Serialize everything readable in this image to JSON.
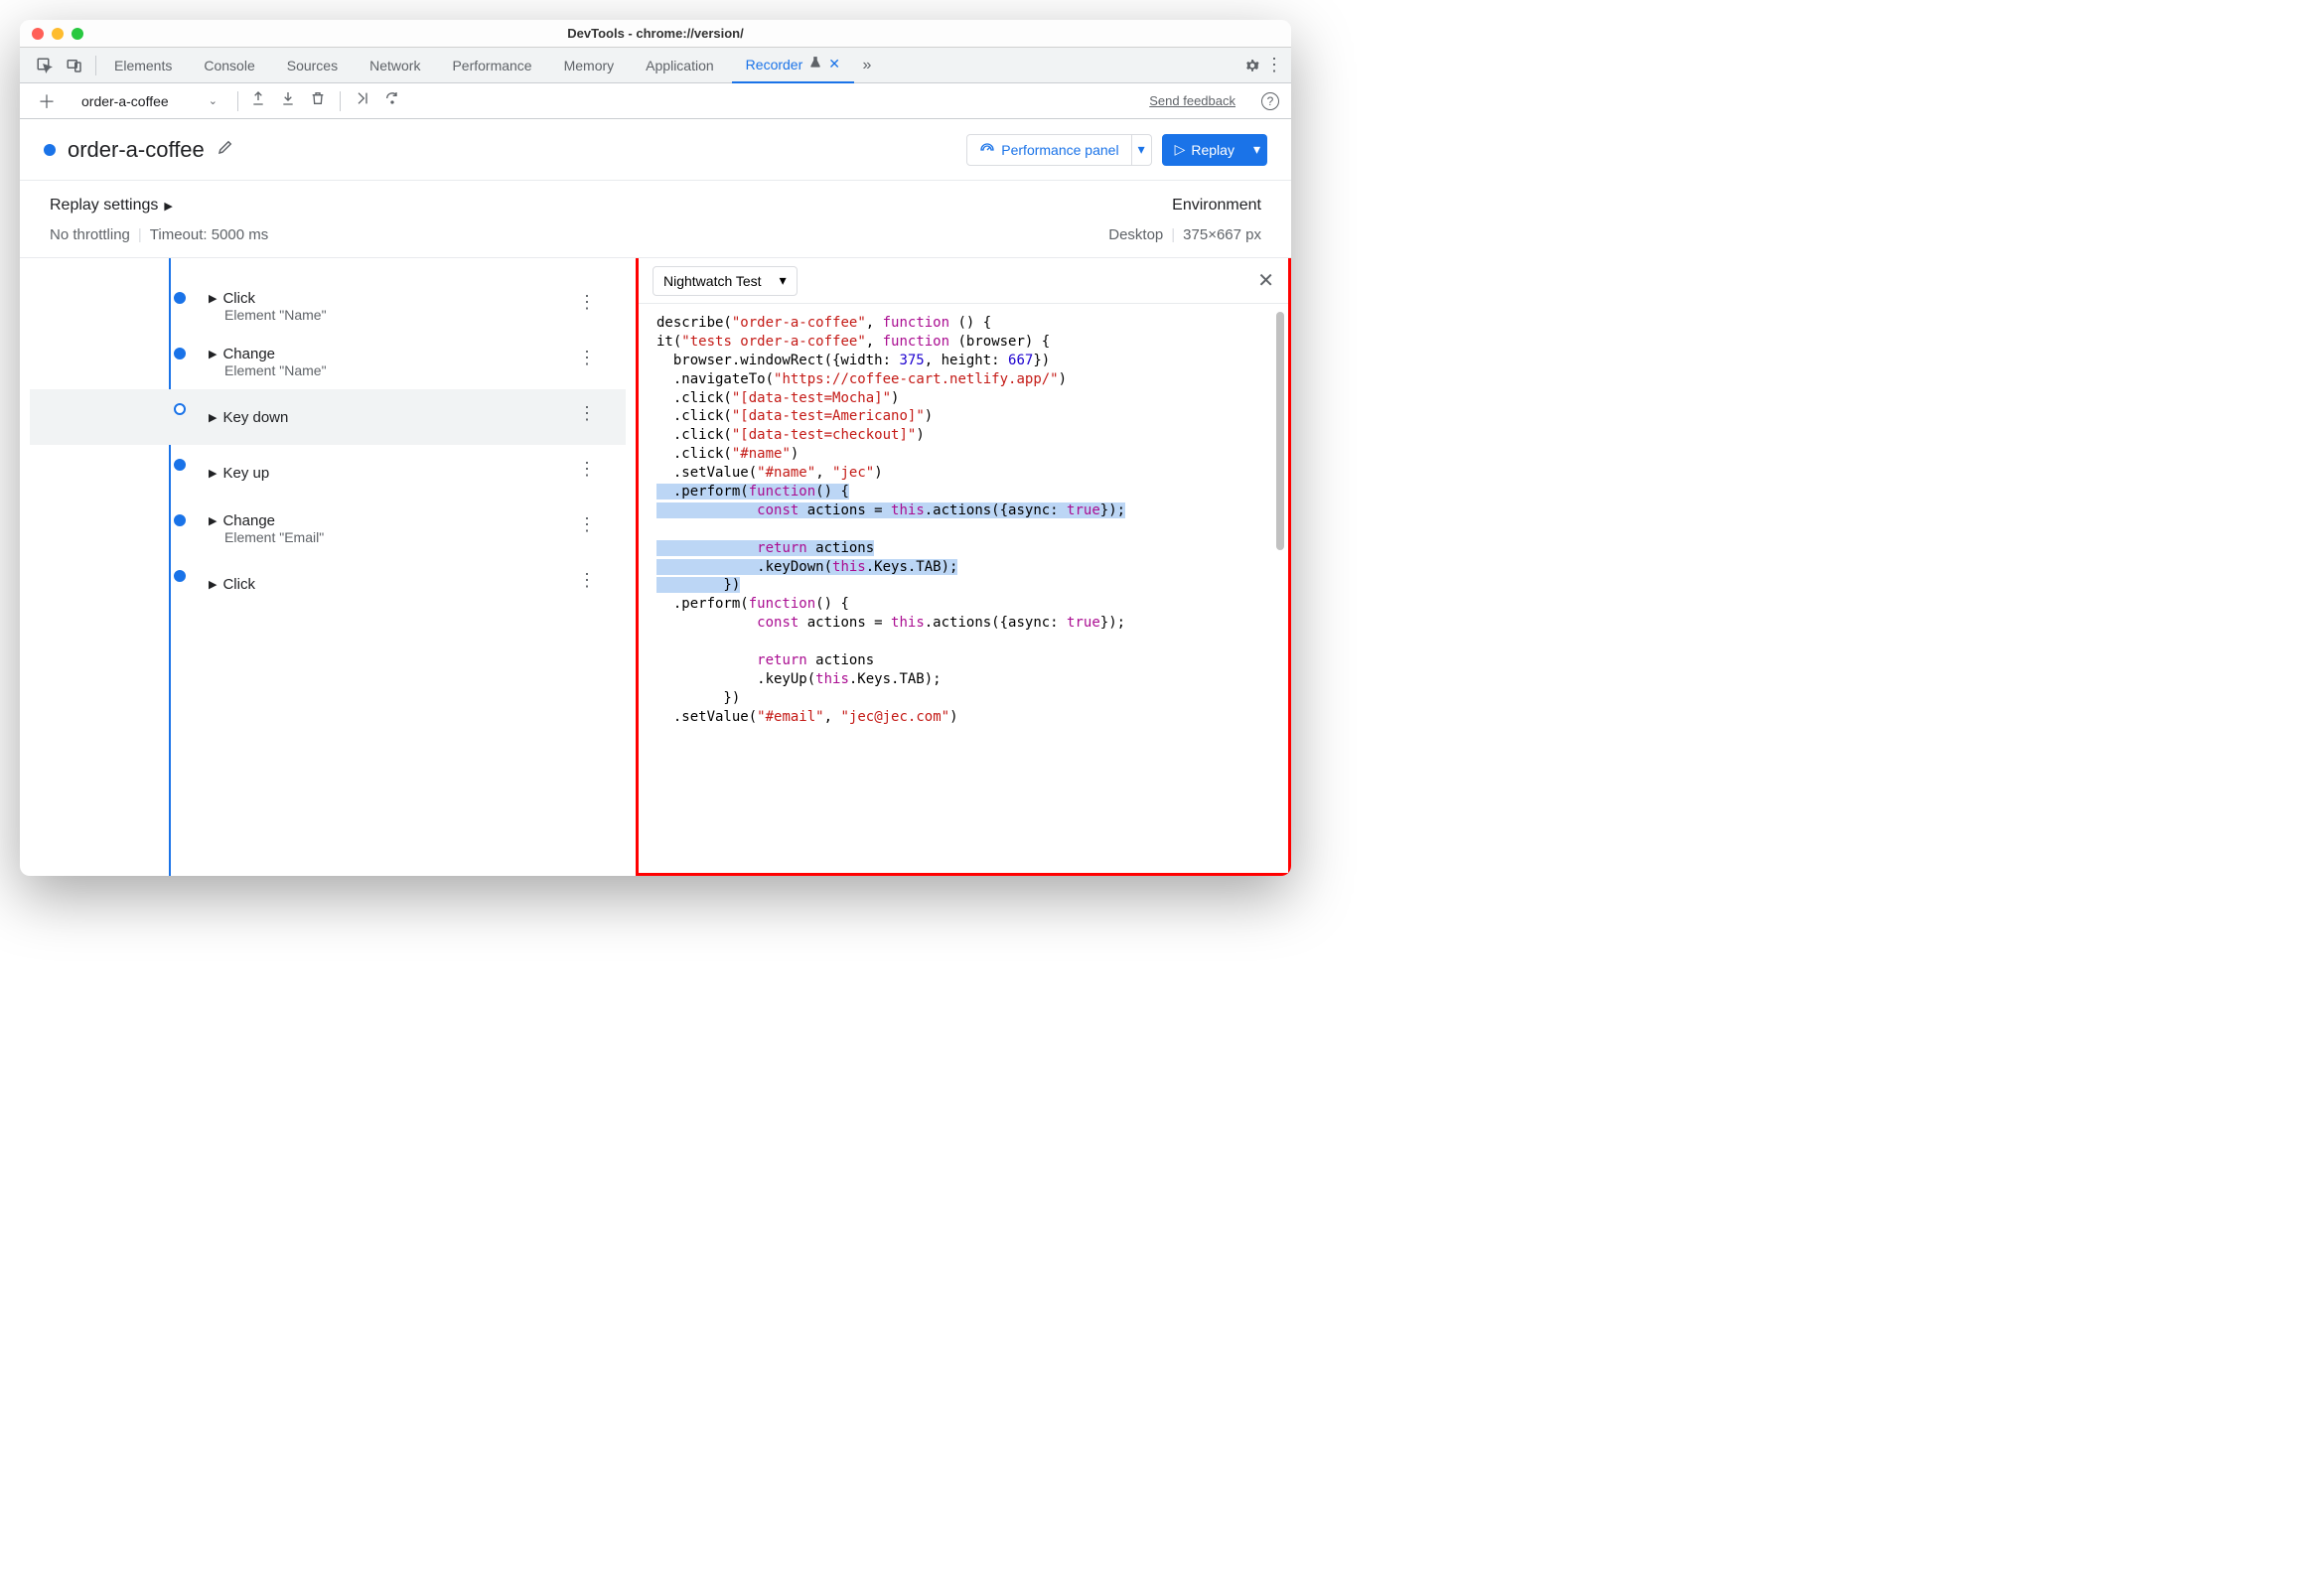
{
  "window": {
    "title": "DevTools - chrome://version/"
  },
  "tabs": {
    "items": [
      "Elements",
      "Console",
      "Sources",
      "Network",
      "Performance",
      "Memory",
      "Application",
      "Recorder"
    ],
    "active": "Recorder"
  },
  "subtoolbar": {
    "recording_name": "order-a-coffee",
    "send_feedback": "Send feedback"
  },
  "header": {
    "recording_title": "order-a-coffee",
    "perf_button": "Performance panel",
    "replay_button": "Replay"
  },
  "settings": {
    "label": "Replay settings",
    "throttling": "No throttling",
    "timeout": "Timeout: 5000 ms",
    "environment_label": "Environment",
    "device": "Desktop",
    "viewport": "375×667 px"
  },
  "steps": [
    {
      "title": "Click",
      "sub": "Element \"Name\""
    },
    {
      "title": "Change",
      "sub": "Element \"Name\""
    },
    {
      "title": "Key down",
      "sub": "",
      "selected": true
    },
    {
      "title": "Key up",
      "sub": ""
    },
    {
      "title": "Change",
      "sub": "Element \"Email\""
    },
    {
      "title": "Click",
      "sub": ""
    }
  ],
  "code_panel": {
    "dropdown": "Nightwatch Test",
    "code": {
      "describe": "order-a-coffee",
      "it": "tests order-a-coffee",
      "width": "375",
      "height": "667",
      "url": "https://coffee-cart.netlify.app/",
      "sel_mocha": "[data-test=Mocha]",
      "sel_americano": "[data-test=Americano]",
      "sel_checkout": "[data-test=checkout]",
      "sel_name": "#name",
      "val_name1": "#name",
      "val_name2": "jec",
      "async_true": "true",
      "sel_email": "#email",
      "val_email": "jec@jec.com"
    }
  }
}
